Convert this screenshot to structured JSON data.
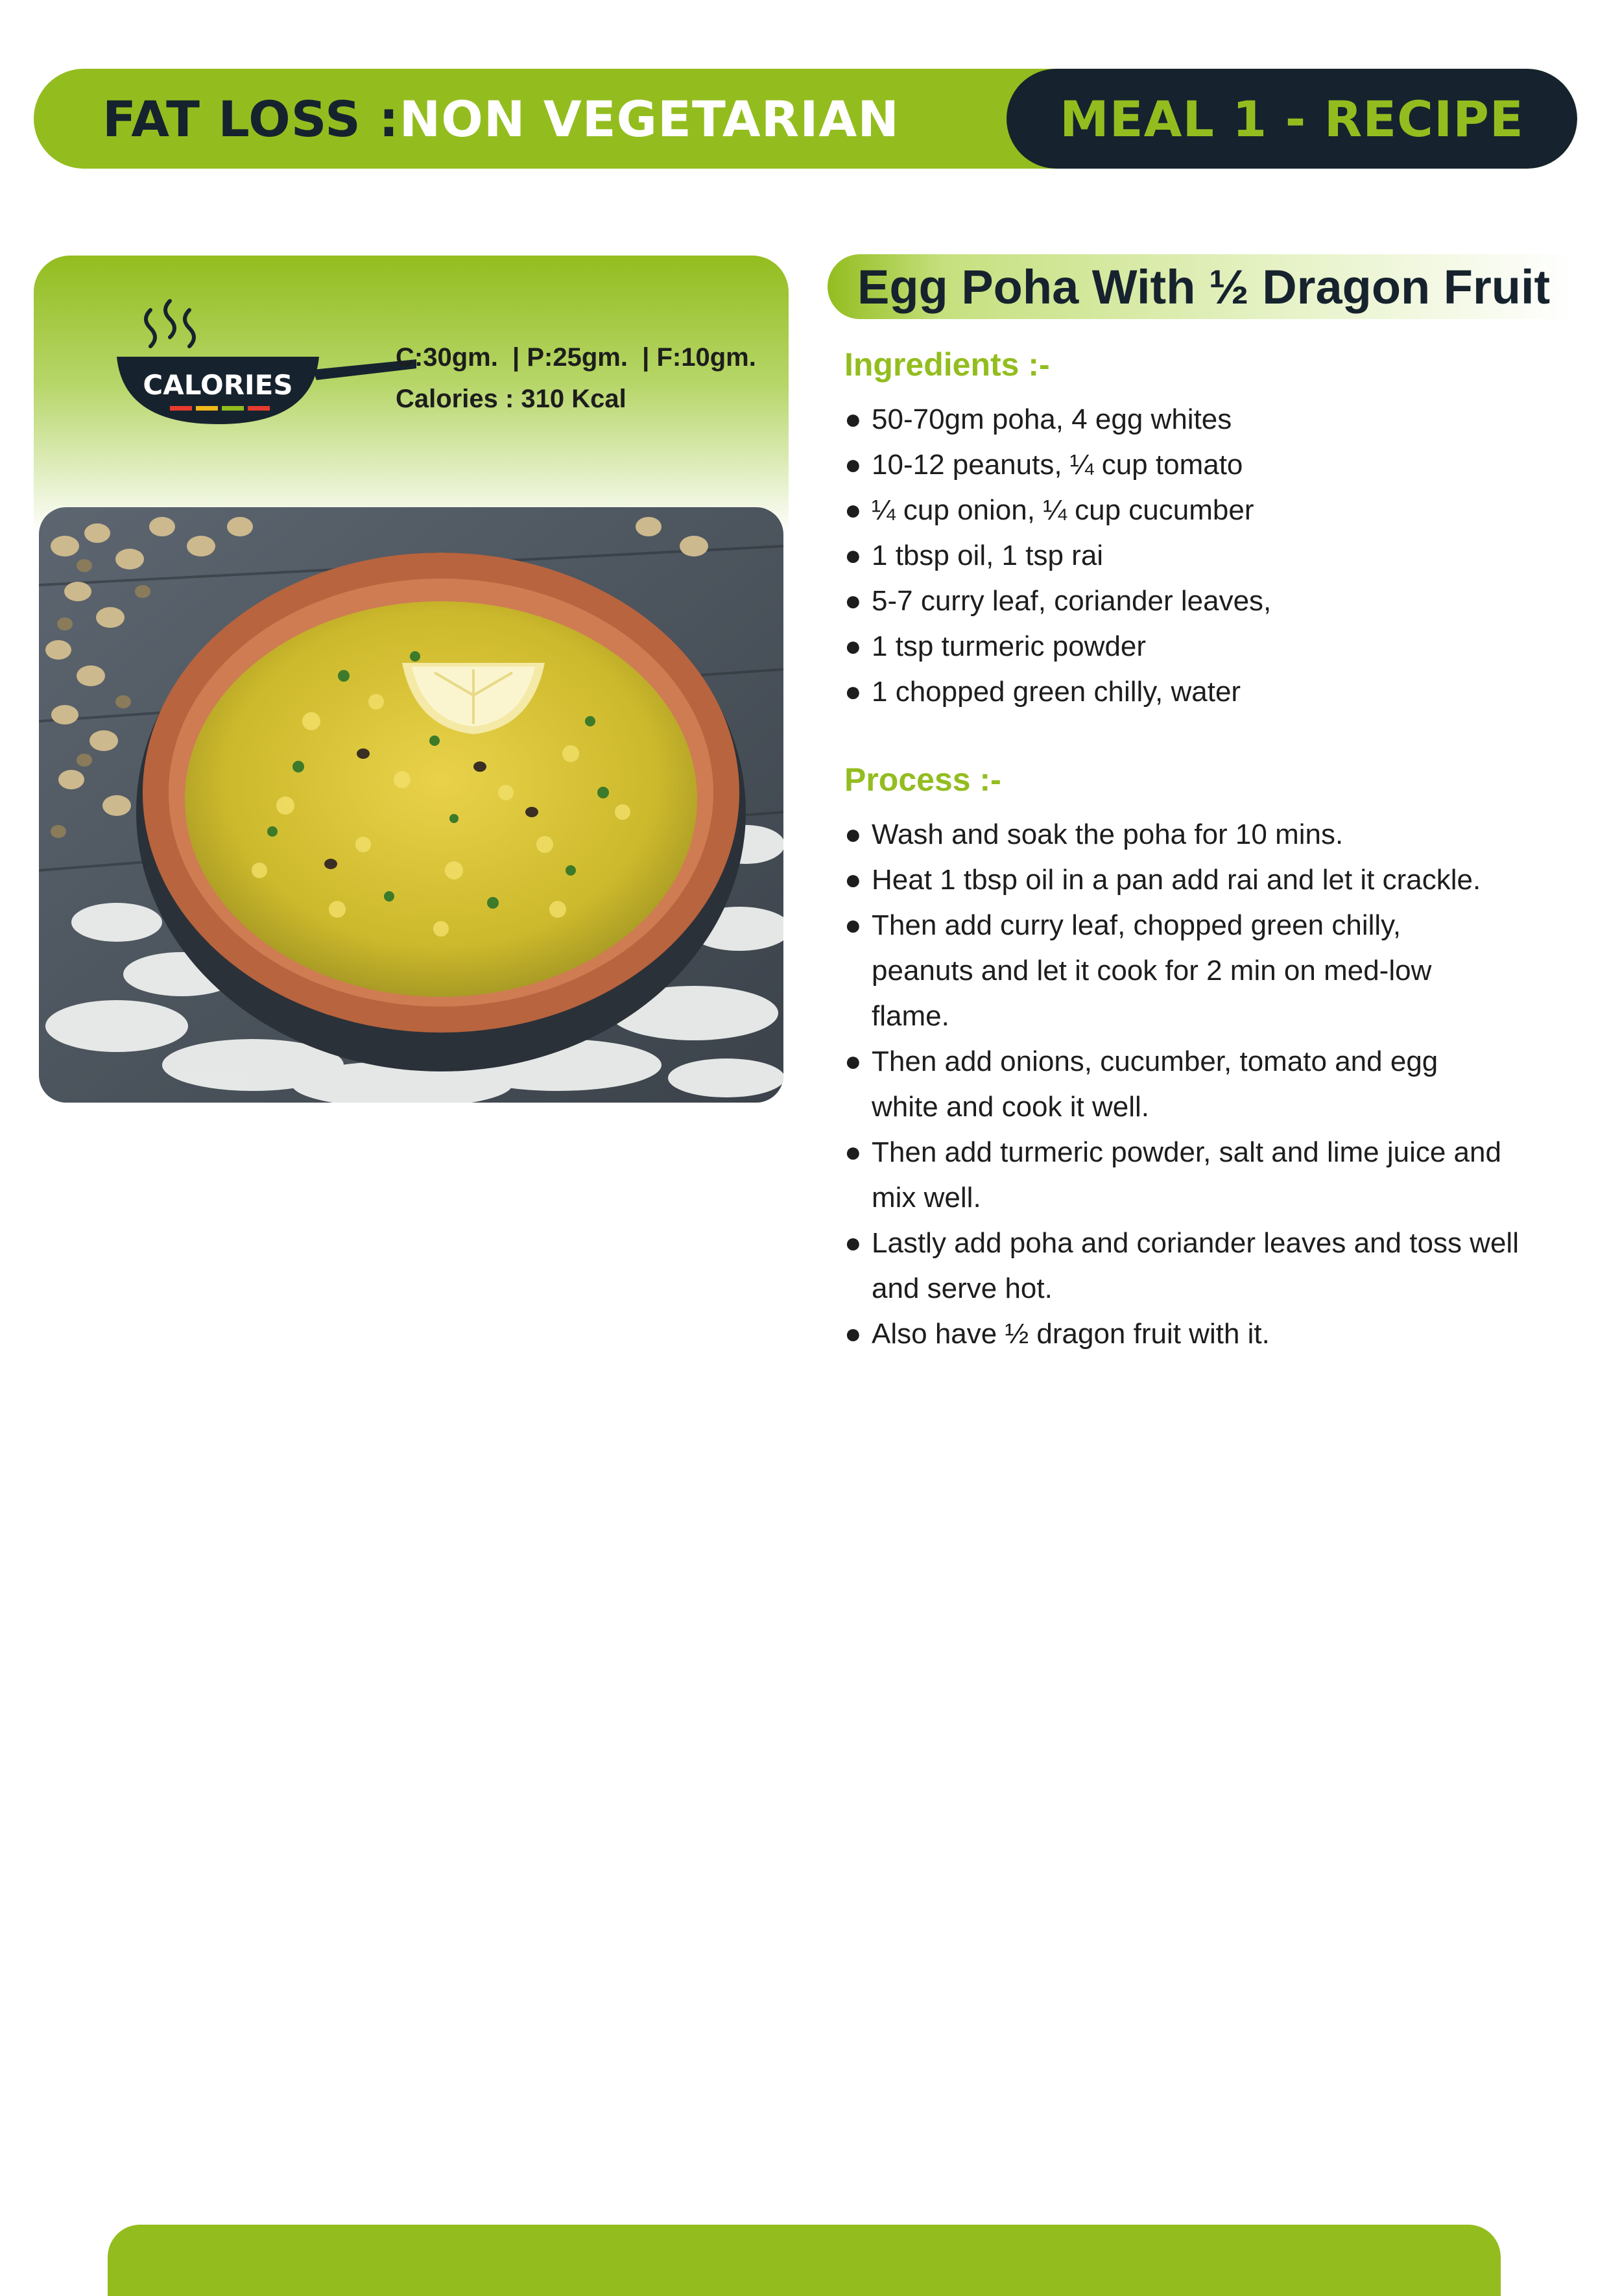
{
  "header": {
    "left_prefix": "FAT LOSS : ",
    "left_emphasis": "NON VEGETARIAN",
    "right_label": "MEAL 1 - RECIPE"
  },
  "card": {
    "logo_text": "CALORIES",
    "macros": "C:30gm.  | P:25gm.  | F:10gm.",
    "calories": "Calories : 310 Kcal"
  },
  "recipe": {
    "title": "Egg Poha With ½ Dragon Fruit",
    "ingredients_heading": "Ingredients :-",
    "ingredients": [
      "50-70gm poha, 4 egg whites",
      "10-12 peanuts, ¼ cup tomato",
      "¼ cup onion, ¼ cup cucumber",
      "1 tbsp oil, 1 tsp rai",
      "5-7 curry leaf, coriander leaves,",
      "1 tsp turmeric powder",
      "1 chopped green chilly, water"
    ],
    "process_heading": "Process :-",
    "process": [
      "Wash and soak the poha for 10 mins.",
      "Heat 1 tbsp oil in a pan add rai and let it crackle.",
      "Then add curry leaf, chopped green chilly, peanuts and let it cook for 2 min on med-low flame.",
      "Then add onions, cucumber, tomato and egg white and cook it well.",
      "Then add turmeric powder, salt and lime juice and mix well.",
      "Lastly add poha and coriander leaves and toss well and serve hot.",
      "Also have ½ dragon fruit with it."
    ],
    "bullet": "●"
  },
  "colors": {
    "brand_green": "#93bd1f",
    "navy": "#16232e",
    "text": "#1d1d1d"
  }
}
